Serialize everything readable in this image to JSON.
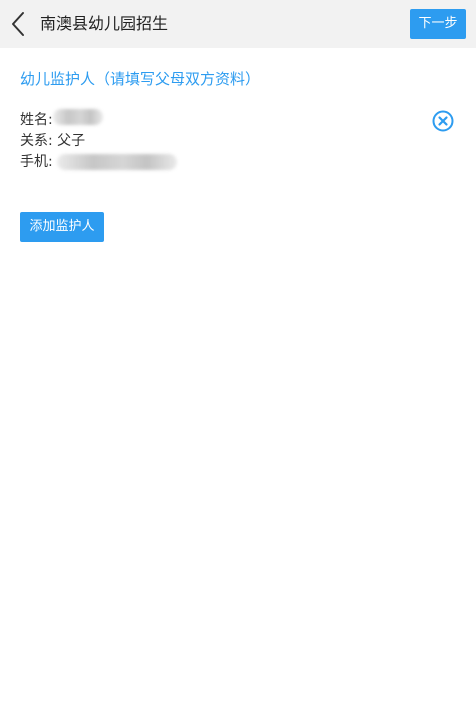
{
  "header": {
    "title": "南澳县幼儿园招生",
    "next_label": "下一步"
  },
  "section": {
    "title": "幼儿监护人（请填写父母双方资料）"
  },
  "guardian": {
    "name_label": "姓名:",
    "relation_label": "关系:",
    "relation_value": "父子",
    "phone_label": "手机:"
  },
  "actions": {
    "add_label": "添加监护人"
  },
  "colors": {
    "accent": "#2d9cf0",
    "header_bg": "#f2f2f2",
    "text": "#333333"
  },
  "icons": {
    "back": "chevron-left-icon",
    "remove": "circle-close-icon"
  }
}
